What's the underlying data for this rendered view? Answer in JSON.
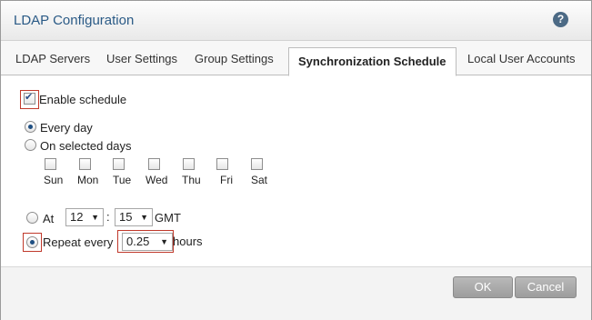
{
  "dialog": {
    "title": "LDAP Configuration",
    "help_icon_glyph": "?"
  },
  "tabs": [
    {
      "label": "LDAP Servers"
    },
    {
      "label": "User Settings"
    },
    {
      "label": "Group Settings"
    },
    {
      "label": "Synchronization Schedule",
      "active": true
    },
    {
      "label": "Local User Accounts"
    }
  ],
  "schedule": {
    "enable_label": "Enable schedule",
    "enable_checked": true,
    "every_day_label": "Every day",
    "selected_days_label": "On selected days",
    "days": [
      "Sun",
      "Mon",
      "Tue",
      "Wed",
      "Thu",
      "Fri",
      "Sat"
    ],
    "at_label": "At",
    "at_hour": "12",
    "at_minute": "15",
    "time_separator": ":",
    "timezone": "GMT",
    "repeat_label": "Repeat every",
    "repeat_value": "0.25",
    "repeat_unit": "hours"
  },
  "footer": {
    "ok_label": "OK",
    "cancel_label": "Cancel"
  },
  "colors": {
    "title": "#2a5a86",
    "highlight": "#c0392b",
    "button": "#a8a8a8"
  }
}
